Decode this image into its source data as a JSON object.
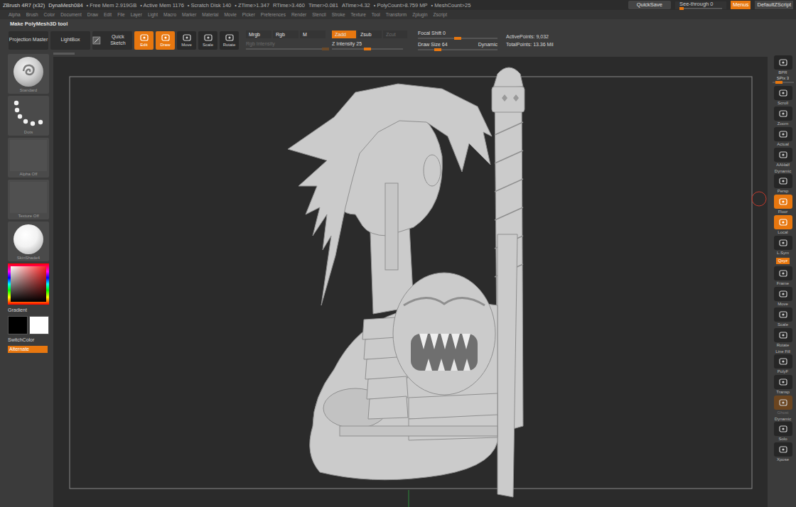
{
  "title_bar": {
    "app": "ZBrush 4R7 (x32)",
    "document": "DynaMesh084",
    "stats": [
      "• Free Mem 2.919GB",
      "• Active Mem 1176",
      "• Scratch Disk 140",
      "• ZTime>1.347",
      "RTime>3.460",
      "Timer>0.081",
      "ATime>4.32",
      "• PolyCount>8.759 MP",
      "• MeshCount>25"
    ],
    "quicksave": "QuickSave",
    "see_through": {
      "label": "See-through",
      "value": "0",
      "level": 0
    },
    "menus_button": {
      "label": "Menus",
      "selected": true
    },
    "script": "DefaultZScript"
  },
  "menus": [
    "Alpha",
    "Brush",
    "Color",
    "Document",
    "Draw",
    "Edit",
    "File",
    "Layer",
    "Light",
    "Macro",
    "Marker",
    "Material",
    "Movie",
    "Picker",
    "Preferences",
    "Render",
    "Stencil",
    "Stroke",
    "Texture",
    "Tool",
    "Transform",
    "Zplugin",
    "Zscript"
  ],
  "tool_action": "Make PolyMesh3D tool",
  "toolbar": {
    "projection_master": "Projection Master",
    "lightbox": "LightBox",
    "quick_sketch": "Quick Sketch",
    "modes": [
      {
        "label": "Edit",
        "selected": true
      },
      {
        "label": "Draw",
        "selected": true
      },
      {
        "label": "Move",
        "selected": false
      },
      {
        "label": "Scale",
        "selected": false
      },
      {
        "label": "Rotate",
        "selected": false
      }
    ],
    "color_modes": [
      {
        "label": "Mrgb",
        "selected": false,
        "disabled": false
      },
      {
        "label": "Rgb",
        "selected": false,
        "disabled": false
      },
      {
        "label": "M",
        "selected": false,
        "disabled": false
      }
    ],
    "rgb_intensity": {
      "label": "Rgb Intensity",
      "disabled": true,
      "level": 1
    },
    "depth_modes": [
      {
        "label": "Zadd",
        "selected": true,
        "disabled": false
      },
      {
        "label": "Zsub",
        "selected": false,
        "disabled": false
      },
      {
        "label": "Zcut",
        "selected": false,
        "disabled": true
      }
    ],
    "z_intensity": {
      "label": "Z Intensity",
      "value": "25",
      "level": 0.5
    },
    "focal_shift": {
      "label": "Focal Shift",
      "value": "0",
      "level": 0.5
    },
    "draw_size": {
      "label": "Draw Size",
      "value": "64",
      "level": 0.25
    },
    "dynamic": "Dynamic",
    "active_points": "ActivePoints: 9,032",
    "total_points": "TotalPoints: 13.36 Mil"
  },
  "left_shelf": {
    "tiles": [
      {
        "label": "Standard",
        "kind": "brush"
      },
      {
        "label": "Dots",
        "kind": "stroke"
      },
      {
        "label": "Alpha Off",
        "kind": "empty"
      },
      {
        "label": "Texture Off",
        "kind": "empty"
      },
      {
        "label": "SkinShade4",
        "kind": "material"
      }
    ],
    "gradient": "Gradient",
    "swatches": [
      {
        "name": "main",
        "color": "#000000"
      },
      {
        "name": "secondary",
        "color": "#ffffff"
      }
    ],
    "switch_color": "SwitchColor",
    "alternate": {
      "label": "Alternate",
      "selected": true
    }
  },
  "right_shelf": [
    {
      "kind": "button",
      "label": "BPR",
      "selected": false,
      "disabled": false
    },
    {
      "kind": "slider",
      "label": "SPix",
      "value": "3",
      "level": 0.3
    },
    {
      "kind": "button",
      "label": "Scroll",
      "selected": false,
      "disabled": false
    },
    {
      "kind": "button",
      "label": "Zoom",
      "selected": false,
      "disabled": false
    },
    {
      "kind": "button",
      "label": "Actual",
      "selected": false,
      "disabled": false
    },
    {
      "kind": "button",
      "label": "AAHalf",
      "selected": false,
      "disabled": false
    },
    {
      "kind": "button",
      "caption": "Dynamic",
      "label": "Persp",
      "selected": false,
      "disabled": false
    },
    {
      "kind": "button",
      "label": "Floor",
      "selected": true,
      "disabled": false
    },
    {
      "kind": "button",
      "label": "Local",
      "selected": true,
      "disabled": false
    },
    {
      "kind": "button",
      "label": "L.Sym",
      "selected": false,
      "disabled": false
    },
    {
      "kind": "toggle",
      "label": "Qxyz",
      "selected": true,
      "disabled": false
    },
    {
      "kind": "button",
      "label": "Frame",
      "selected": false,
      "disabled": false
    },
    {
      "kind": "button",
      "label": "Move",
      "selected": false,
      "disabled": false
    },
    {
      "kind": "button",
      "label": "Scale",
      "selected": false,
      "disabled": false
    },
    {
      "kind": "button",
      "label": "Rotate",
      "selected": false,
      "disabled": false
    },
    {
      "kind": "button",
      "caption": "Line Fill",
      "label": "PolyF",
      "selected": false,
      "disabled": false
    },
    {
      "kind": "button",
      "label": "Transp",
      "selected": false,
      "disabled": false
    },
    {
      "kind": "button",
      "label": "Ghost",
      "selected": false,
      "disabled": true
    },
    {
      "kind": "button",
      "caption": "Dynamic",
      "label": "Solo",
      "selected": false,
      "disabled": false
    },
    {
      "kind": "button",
      "label": "Xpose",
      "selected": false,
      "disabled": false
    }
  ]
}
